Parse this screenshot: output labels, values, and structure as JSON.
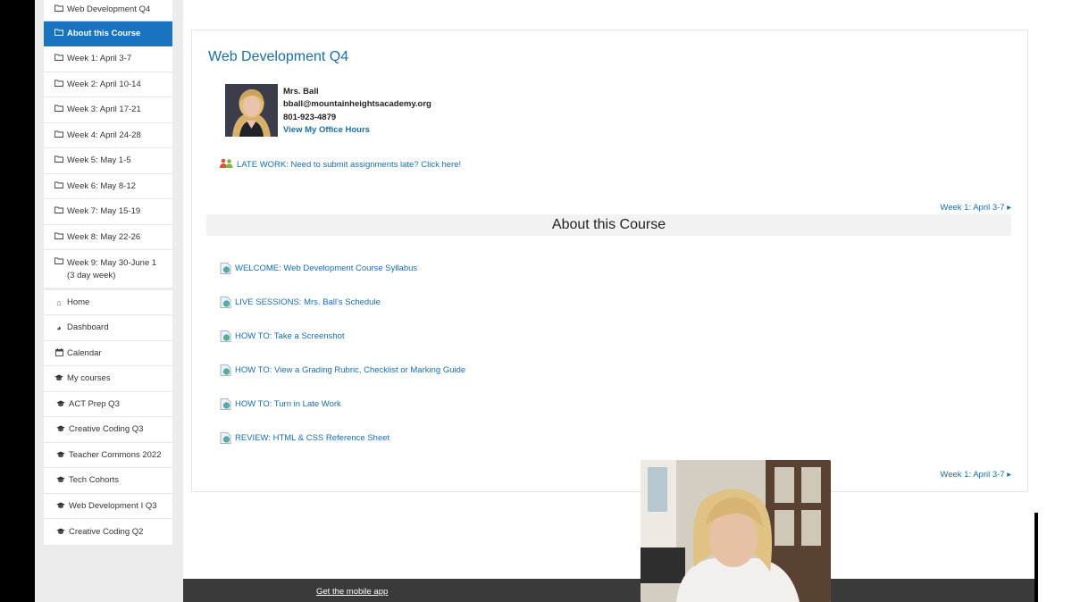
{
  "sidebar": {
    "sections": [
      {
        "label": "Web Development Q4",
        "icon": "folder-icon",
        "active": false
      },
      {
        "label": "About this Course",
        "icon": "folder-icon",
        "active": true
      },
      {
        "label": "Week 1: April 3-7",
        "icon": "folder-icon",
        "active": false
      },
      {
        "label": "Week 2: April 10-14",
        "icon": "folder-icon",
        "active": false
      },
      {
        "label": "Week 3: April 17-21",
        "icon": "folder-icon",
        "active": false
      },
      {
        "label": "Week 4: April 24-28",
        "icon": "folder-icon",
        "active": false
      },
      {
        "label": "Week 5: May 1-5",
        "icon": "folder-icon",
        "active": false
      },
      {
        "label": "Week 6: May 8-12",
        "icon": "folder-icon",
        "active": false
      },
      {
        "label": "Week 7: May 15-19",
        "icon": "folder-icon",
        "active": false
      },
      {
        "label": "Week 8: May 22-26",
        "icon": "folder-icon",
        "active": false
      },
      {
        "label": "Week 9: May 30-June 1 (3 day week)",
        "icon": "folder-icon",
        "active": false
      }
    ],
    "nav": [
      {
        "label": "Home",
        "icon": "home-icon"
      },
      {
        "label": "Dashboard",
        "icon": "dashboard-icon"
      },
      {
        "label": "Calendar",
        "icon": "calendar-icon"
      },
      {
        "label": "My courses",
        "icon": "graduation-cap-icon"
      }
    ],
    "courses": [
      {
        "label": "ACT Prep Q3",
        "icon": "graduation-cap-icon"
      },
      {
        "label": "Creative Coding Q3",
        "icon": "graduation-cap-icon"
      },
      {
        "label": "Teacher Commons 2022",
        "icon": "graduation-cap-icon"
      },
      {
        "label": "Tech Cohorts",
        "icon": "graduation-cap-icon"
      },
      {
        "label": "Web Development I Q3",
        "icon": "graduation-cap-icon"
      },
      {
        "label": "Creative Coding Q2",
        "icon": "graduation-cap-icon"
      }
    ]
  },
  "main": {
    "course_title": "Web Development Q4",
    "teacher": {
      "name": "Mrs. Ball",
      "email": "bball@mountainheightsacademy.org",
      "phone": "801-923-4879",
      "office_hours_link": "View My Office Hours"
    },
    "late_work": "LATE WORK: Need to submit assignments late? Click here!",
    "next_section_top": "Week 1: April 3-7 ▸",
    "section_title": "About this Course",
    "resources": [
      {
        "label": "WELCOME: Web Development Course Syllabus",
        "icon": "url-resource-icon"
      },
      {
        "label": "LIVE SESSIONS: Mrs. Ball's Schedule",
        "icon": "url-resource-icon"
      },
      {
        "label": "HOW TO: Take a Screenshot",
        "icon": "url-resource-icon"
      },
      {
        "label": "HOW TO: View a Grading Rubric, Checklist or Marking Guide",
        "icon": "url-resource-icon"
      },
      {
        "label": "HOW TO: Turn in Late Work",
        "icon": "url-resource-icon"
      },
      {
        "label": "REVIEW: HTML & CSS Reference Sheet",
        "icon": "url-resource-icon"
      }
    ],
    "next_section_bottom": "Week 1: April 3-7 ▸"
  },
  "footer": {
    "mobile_app_link": "Get the mobile app"
  },
  "colors": {
    "accent": "#1a73be",
    "link": "#1a6ea8",
    "footer": "#3a3a3a"
  }
}
